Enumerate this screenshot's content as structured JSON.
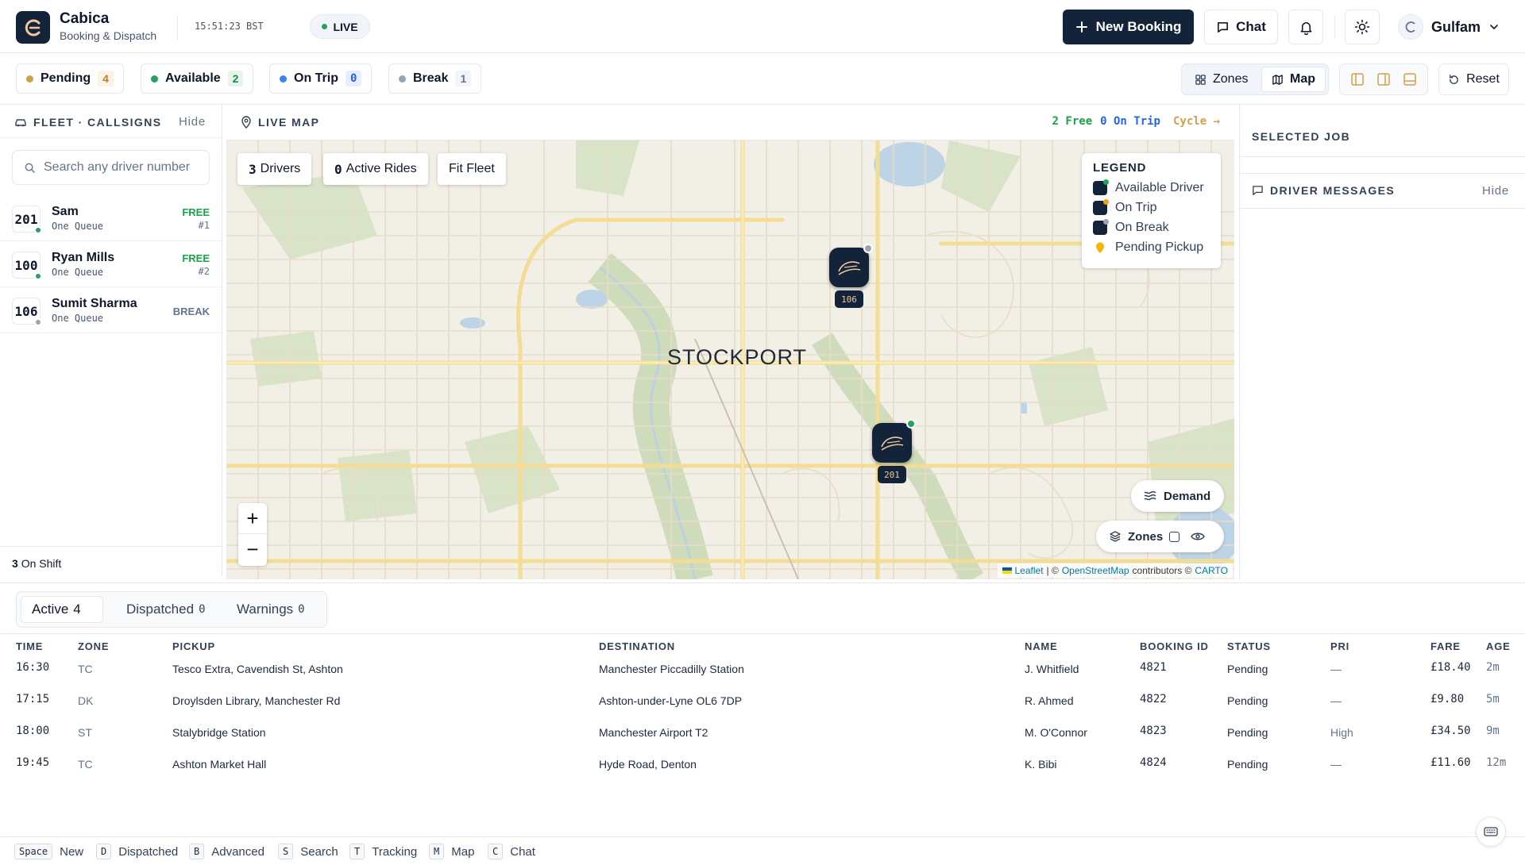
{
  "header": {
    "brand_name": "Cabica",
    "brand_sub": "Booking & Dispatch",
    "clock": "15:51:23 BST",
    "live_label": "LIVE",
    "new_booking": "New Booking",
    "chat": "Chat",
    "user_name": "Gulfam"
  },
  "status": {
    "chips": [
      {
        "label": "Pending",
        "count": "4",
        "color": "#d1a04c"
      },
      {
        "label": "Available",
        "count": "2",
        "color": "#22a35a"
      },
      {
        "label": "On Trip",
        "count": "0",
        "color": "#3b82f6"
      },
      {
        "label": "Break",
        "count": "1",
        "color": "#94a3b8"
      }
    ],
    "view_zones": "Zones",
    "view_map": "Map",
    "reset": "Reset"
  },
  "fleet": {
    "title": "FLEET · CALLSIGNS",
    "hide": "Hide",
    "search_placeholder": "Search any driver number",
    "drivers": [
      {
        "callsign": "201",
        "name": "Sam",
        "queue": "One Queue",
        "status": "FREE",
        "position": "#1",
        "status_color": "#16a34a",
        "dot_color": "#22a35a"
      },
      {
        "callsign": "100",
        "name": "Ryan Mills",
        "queue": "One Queue",
        "status": "FREE",
        "position": "#2",
        "status_color": "#16a34a",
        "dot_color": "#22a35a"
      },
      {
        "callsign": "106",
        "name": "Sumit Sharma",
        "queue": "One Queue",
        "status": "BREAK",
        "position": "",
        "status_color": "#64748b",
        "dot_color": "#9ca3af"
      }
    ],
    "on_shift_count": "3",
    "on_shift_label": "On Shift"
  },
  "map": {
    "title": "LIVE MAP",
    "stats_free": "2 Free",
    "stats_trip": "0 On Trip",
    "cycle": "Cycle →",
    "drivers_count": "3",
    "drivers_label": "Drivers",
    "rides_count": "0",
    "rides_label": "Active Rides",
    "fit_fleet": "Fit Fleet",
    "legend_title": "LEGEND",
    "legend": [
      {
        "label": "Available Driver",
        "color": "#22a35a"
      },
      {
        "label": "On Trip",
        "color": "#f59e0b"
      },
      {
        "label": "On Break",
        "color": "#9ca3af"
      },
      {
        "label": "Pending Pickup",
        "color": "#f5b400"
      }
    ],
    "city": "STOCKPORT",
    "marker_a": "106",
    "marker_b": "201",
    "zoom_in": "+",
    "zoom_out": "−",
    "demand": "Demand",
    "zones": "Zones",
    "attr_leaflet": "Leaflet",
    "attr_sep": "| ©",
    "attr_osm": "OpenStreetMap",
    "attr_contrib": "contributors ©",
    "attr_carto": "CARTO"
  },
  "right": {
    "selected_job": "SELECTED JOB",
    "driver_messages": "DRIVER MESSAGES",
    "hide": "Hide"
  },
  "jobs": {
    "tabs": [
      {
        "label": "Active",
        "count": "4"
      },
      {
        "label": "Dispatched",
        "count": "0"
      },
      {
        "label": "Warnings",
        "count": "0"
      }
    ],
    "columns": [
      "TIME",
      "ZONE",
      "PICKUP",
      "DESTINATION",
      "NAME",
      "BOOKING ID",
      "STATUS",
      "PRI",
      "FARE",
      "AGE"
    ],
    "rows": [
      {
        "time": "16:30",
        "zone": "TC",
        "pickup": "Tesco Extra, Cavendish St, Ashton",
        "destination": "Manchester Piccadilly Station",
        "name": "J. Whitfield",
        "booking_id": "4821",
        "status": "Pending",
        "pri": "—",
        "fare": "£18.40",
        "age": "2m"
      },
      {
        "time": "17:15",
        "zone": "DK",
        "pickup": "Droylsden Library, Manchester Rd",
        "destination": "Ashton-under-Lyne OL6 7DP",
        "name": "R. Ahmed",
        "booking_id": "4822",
        "status": "Pending",
        "pri": "—",
        "fare": "£9.80",
        "age": "5m"
      },
      {
        "time": "18:00",
        "zone": "ST",
        "pickup": "Stalybridge Station",
        "destination": "Manchester Airport T2",
        "name": "M. O'Connor",
        "booking_id": "4823",
        "status": "Pending",
        "pri": "High",
        "fare": "£34.50",
        "age": "9m"
      },
      {
        "time": "19:45",
        "zone": "TC",
        "pickup": "Ashton Market Hall",
        "destination": "Hyde Road, Denton",
        "name": "K. Bibi",
        "booking_id": "4824",
        "status": "Pending",
        "pri": "—",
        "fare": "£11.60",
        "age": "12m"
      }
    ]
  },
  "shortcuts": [
    {
      "key": "Space",
      "label": "New"
    },
    {
      "key": "D",
      "label": "Dispatched"
    },
    {
      "key": "B",
      "label": "Advanced"
    },
    {
      "key": "S",
      "label": "Search"
    },
    {
      "key": "T",
      "label": "Tracking"
    },
    {
      "key": "M",
      "label": "Map"
    },
    {
      "key": "C",
      "label": "Chat"
    }
  ]
}
